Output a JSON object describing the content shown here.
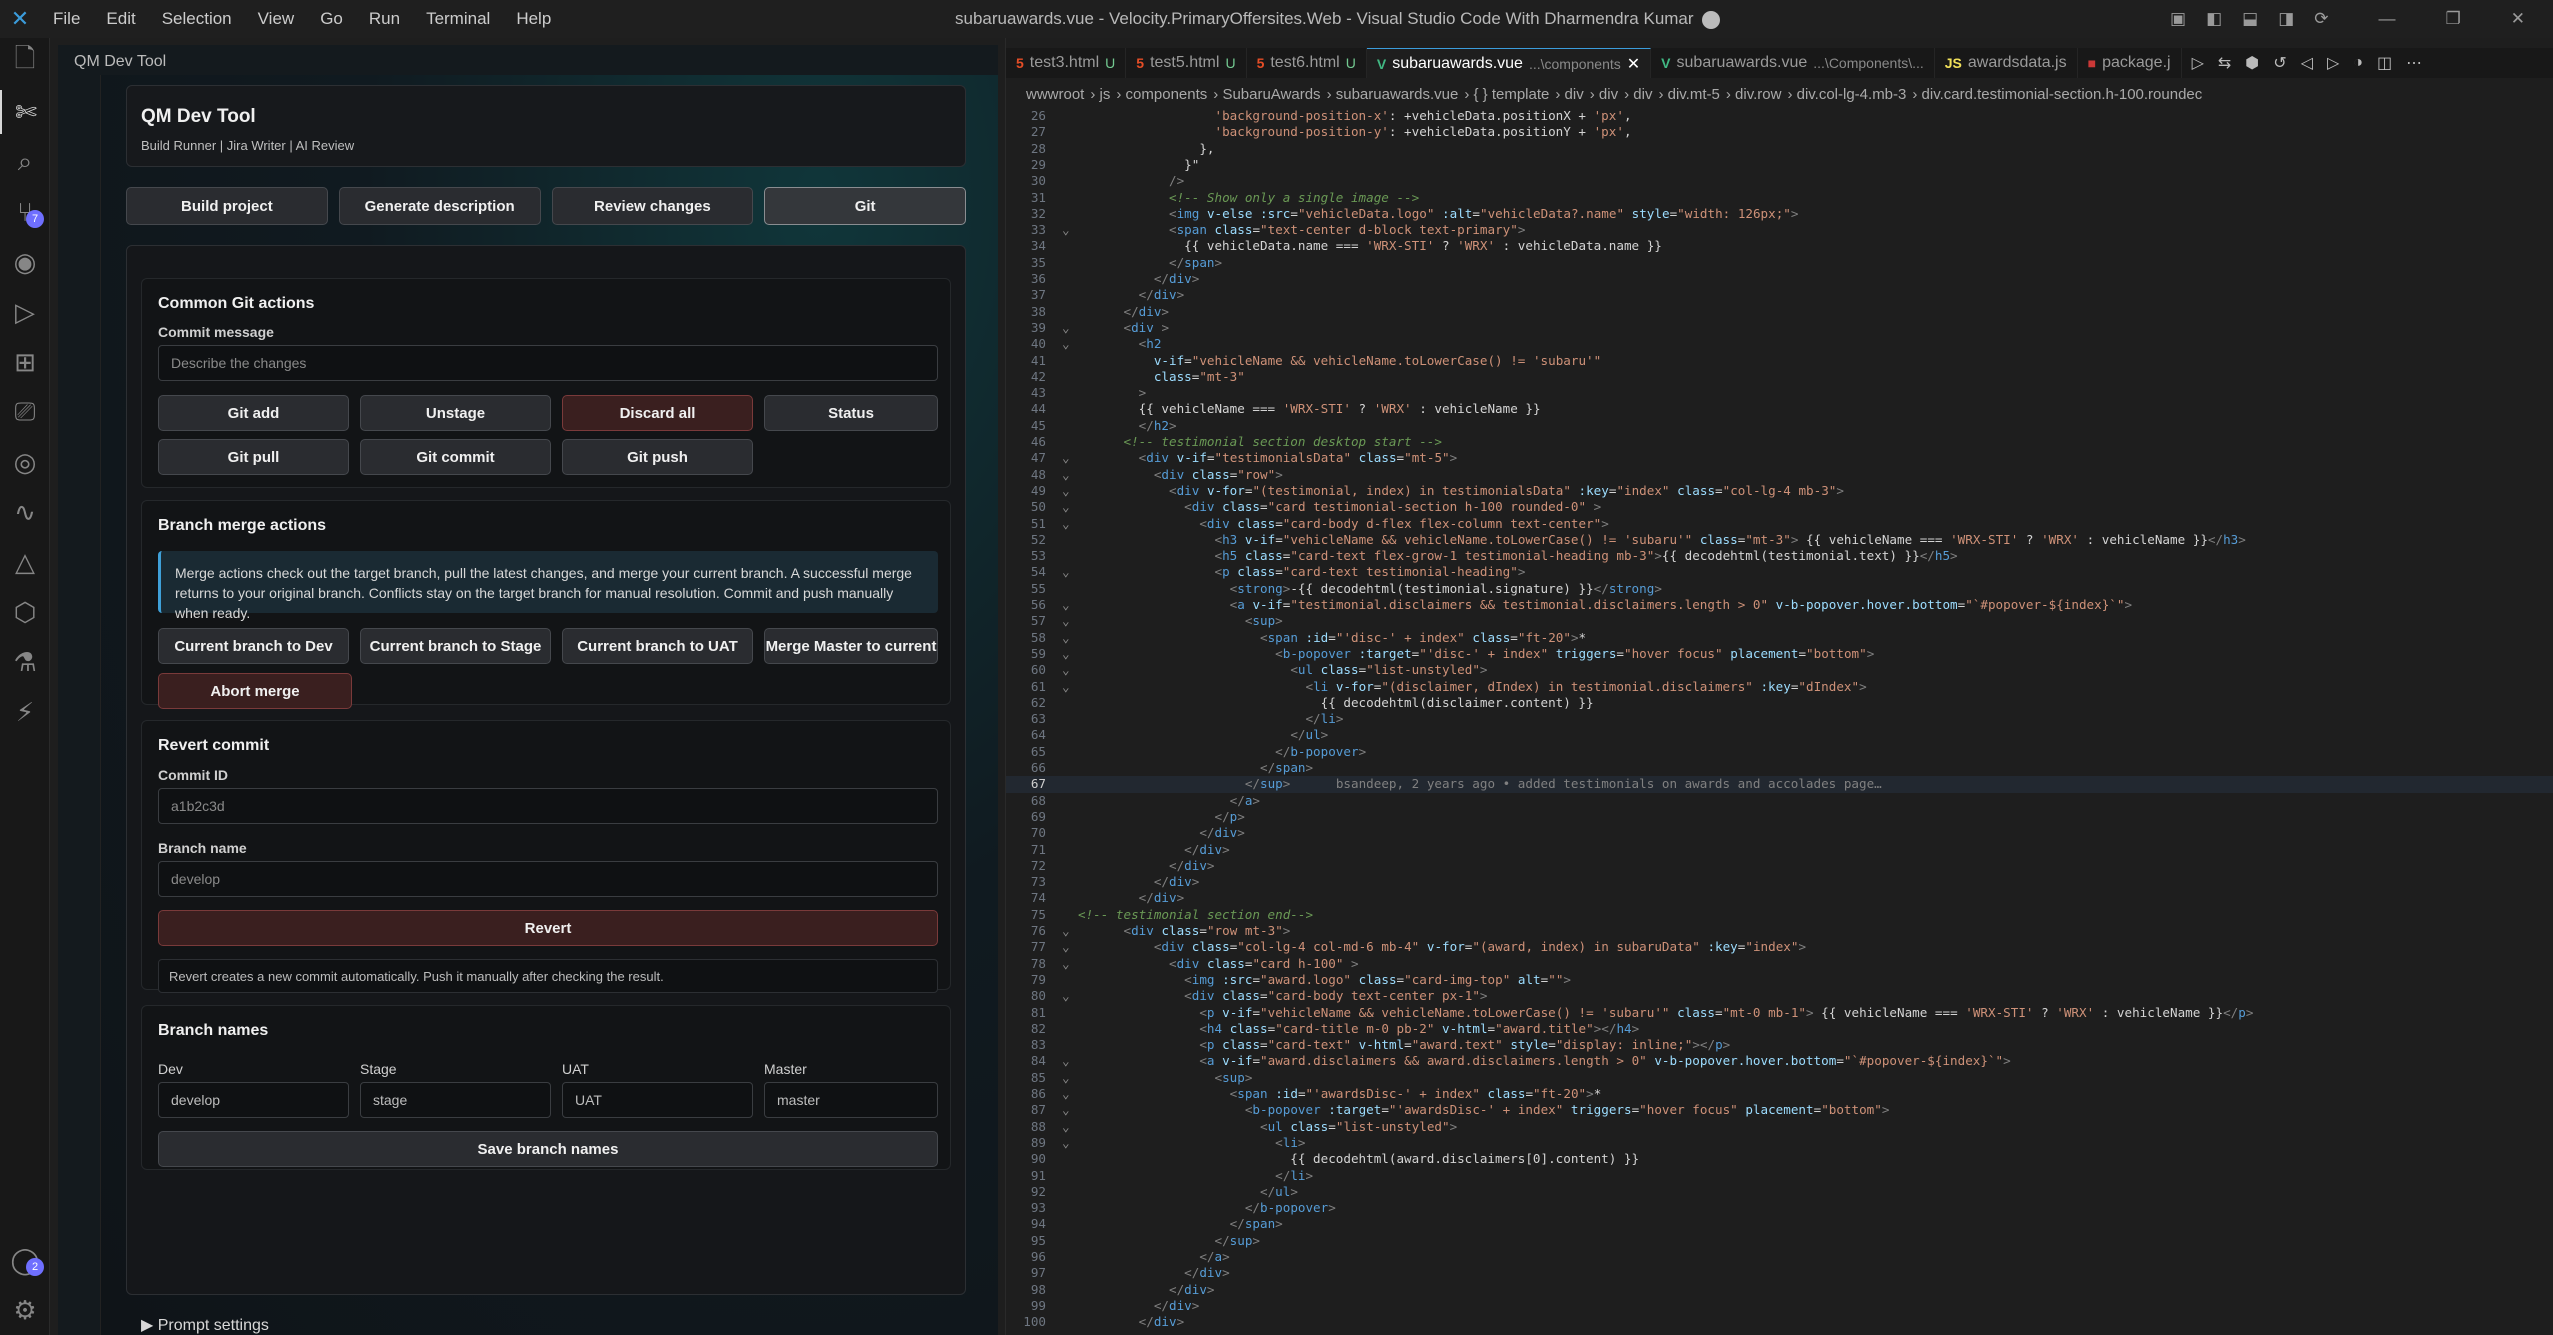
{
  "titlebar": {
    "menu": [
      "File",
      "Edit",
      "Selection",
      "View",
      "Go",
      "Run",
      "Terminal",
      "Help"
    ],
    "title": "subaruawards.vue - Velocity.PrimaryOffersites.Web - Visual Studio Code With Dharmendra Kumar"
  },
  "activity": {
    "badge_source_control": "7",
    "badge_accounts": "2"
  },
  "panel": {
    "title": "QM Dev Tool"
  },
  "tool": {
    "title": "QM Dev Tool",
    "subtitle": "Build Runner | Jira Writer | AI Review",
    "tabs": [
      "Build project",
      "Generate description",
      "Review changes",
      "Git"
    ],
    "common": {
      "heading": "Common Git actions",
      "commit_label": "Commit message",
      "commit_placeholder": "Describe the changes",
      "buttons": [
        "Git add",
        "Unstage",
        "Discard all",
        "Status",
        "Git pull",
        "Git commit",
        "Git push"
      ]
    },
    "merge": {
      "heading": "Branch merge actions",
      "info": "Merge actions check out the target branch, pull the latest changes, and merge your current branch. A successful merge returns to your original branch. Conflicts stay on the target branch for manual resolution. Commit and push manually when ready.",
      "buttons": [
        "Current branch to Dev",
        "Current branch to Stage",
        "Current branch to UAT",
        "Merge Master to current",
        "Abort merge"
      ]
    },
    "revert": {
      "heading": "Revert commit",
      "commit_id_label": "Commit ID",
      "commit_id_placeholder": "a1b2c3d",
      "branch_label": "Branch name",
      "branch_placeholder": "develop",
      "button": "Revert",
      "note": "Revert creates a new commit automatically. Push it manually after checking the result."
    },
    "branches": {
      "heading": "Branch names",
      "labels": [
        "Dev",
        "Stage",
        "UAT",
        "Master"
      ],
      "values": [
        "develop",
        "stage",
        "UAT",
        "master"
      ],
      "button": "Save branch names"
    },
    "prompt": "Prompt settings"
  },
  "editor": {
    "tabs": [
      {
        "name": "test3.html",
        "mark": "U"
      },
      {
        "name": "test5.html",
        "mark": "U"
      },
      {
        "name": "test6.html",
        "mark": "U"
      },
      {
        "name": "subaruawards.vue",
        "path": "...\\components"
      },
      {
        "name": "subaruawards.vue",
        "path": "...\\Components\\..."
      },
      {
        "name": "awardsdata.js"
      },
      {
        "name": "package.j"
      }
    ],
    "breadcrumbs": [
      "wwwroot",
      "js",
      "components",
      "SubaruAwards",
      "subaruawards.vue",
      "{ } template",
      "div",
      "div",
      "div",
      "div.mt-5",
      "div.row",
      "div.col-lg-4.mb-3",
      "div.card.testimonial-section.h-100.roundec"
    ],
    "blame": "bsandeep, 2 years ago • added testimonials on awards and accolades page…"
  }
}
